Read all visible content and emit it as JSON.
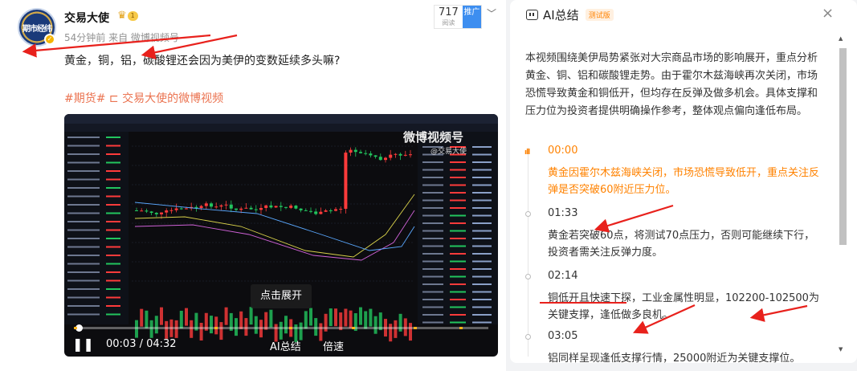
{
  "post": {
    "avatar_text": "期市经纬",
    "username": "交易大使",
    "level": "1",
    "meta": "54分钟前 来自 微博视频号",
    "text": "黄金，铜，铝，碳酸锂还会因为美伊的变数延续多头嘛?",
    "topic": "#期货# ⊏ 交易大使的微博视频",
    "views_count": "717",
    "views_label": "阅读",
    "promote_label": "推广"
  },
  "video": {
    "watermark": "微博视频号",
    "watermark_sub": "@交易大使",
    "expand_label": "点击展开",
    "current_time": "00:03",
    "duration": "04:32",
    "timecode": "00:03 / 04:32",
    "progress": 0.011,
    "ai_summary_label": "AI总结",
    "speed_label": "倍速",
    "pause_icon": "pause-icon",
    "chapter_markers": [
      0.0,
      0.34,
      0.52,
      0.67,
      0.82,
      0.93
    ]
  },
  "panel": {
    "title": "AI总结",
    "beta_badge": "测试版",
    "close_label": "×",
    "summary": "本视频围绕美伊局势紧张对大宗商品市场的影响展开，重点分析黄金、铜、铝和碳酸锂走势。由于霍尔木兹海峡再次关闭，市场恐慌导致黄金和铜低开，但均存在反弹及做多机会。具体支撑和压力位为投资者提供明确操作参考，整体观点偏向逢低布局。",
    "timeline": [
      {
        "time": "00:00",
        "text": "黄金因霍尔木兹海峡关闭，市场恐慌导致低开，重点关注反弹是否突破60附近压力位。",
        "active": true
      },
      {
        "time": "01:33",
        "text": "黄金若突破60点，将测试70点压力，否则可能继续下行，投资者需关注反弹力度。",
        "active": false
      },
      {
        "time": "02:14",
        "text": "铜低开且快速下探，工业金属性明显，102200-102500为关键支撑，逢低做多良机。",
        "active": false
      },
      {
        "time": "03:05",
        "text": "铝同样呈现逢低支撑行情，25000附近为关键支撑位。",
        "active": false
      }
    ]
  },
  "colors": {
    "accent_orange": "#ff8200",
    "topic_orange": "#eb7350",
    "annotation_red": "#e8211c",
    "candle_up": "#ff3b3b",
    "candle_down": "#22c55e"
  }
}
